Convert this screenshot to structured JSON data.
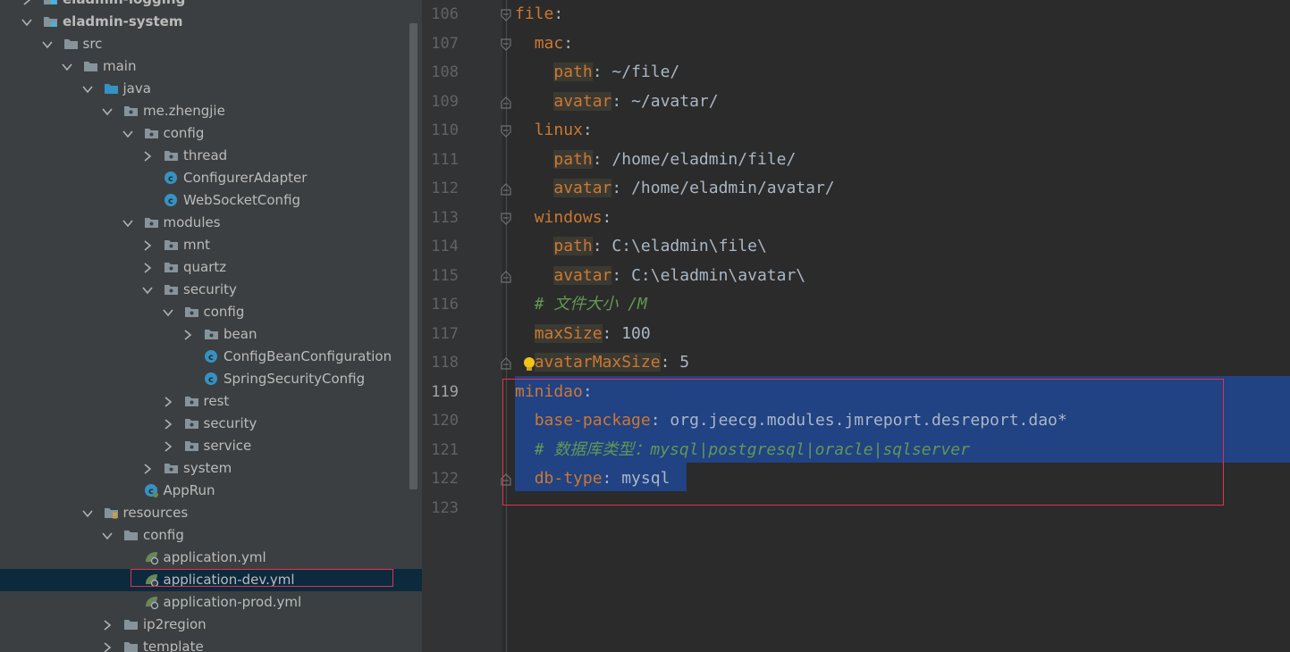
{
  "project_tree": {
    "rows": [
      {
        "label": "eladmin-logging",
        "icon": "module-folder-icon",
        "expanded": false,
        "bold": true
      },
      {
        "label": "eladmin-system",
        "icon": "module-folder-icon",
        "expanded": true,
        "bold": true
      },
      {
        "label": "src",
        "icon": "folder-icon",
        "expanded": true
      },
      {
        "label": "main",
        "icon": "folder-icon",
        "expanded": true
      },
      {
        "label": "java",
        "icon": "source-folder-icon",
        "expanded": true
      },
      {
        "label": "me.zhengjie",
        "icon": "package-icon",
        "expanded": true
      },
      {
        "label": "config",
        "icon": "package-icon",
        "expanded": true
      },
      {
        "label": "thread",
        "icon": "package-icon",
        "expanded": false
      },
      {
        "label": "ConfigurerAdapter",
        "icon": "java-class-icon"
      },
      {
        "label": "WebSocketConfig",
        "icon": "java-class-icon"
      },
      {
        "label": "modules",
        "icon": "package-icon",
        "expanded": true
      },
      {
        "label": "mnt",
        "icon": "package-icon",
        "expanded": false
      },
      {
        "label": "quartz",
        "icon": "package-icon",
        "expanded": false
      },
      {
        "label": "security",
        "icon": "package-icon",
        "expanded": true
      },
      {
        "label": "config",
        "icon": "package-icon",
        "expanded": true
      },
      {
        "label": "bean",
        "icon": "package-icon",
        "expanded": false
      },
      {
        "label": "ConfigBeanConfiguration",
        "icon": "java-class-icon"
      },
      {
        "label": "SpringSecurityConfig",
        "icon": "java-class-icon"
      },
      {
        "label": "rest",
        "icon": "package-icon",
        "expanded": false
      },
      {
        "label": "security",
        "icon": "package-icon",
        "expanded": false
      },
      {
        "label": "service",
        "icon": "package-icon",
        "expanded": false
      },
      {
        "label": "system",
        "icon": "package-icon",
        "expanded": false
      },
      {
        "label": "AppRun",
        "icon": "spring-boot-class-icon"
      },
      {
        "label": "resources",
        "icon": "resources-folder-icon",
        "expanded": true
      },
      {
        "label": "config",
        "icon": "folder-icon",
        "expanded": true
      },
      {
        "label": "application.yml",
        "icon": "spring-yml-icon"
      },
      {
        "label": "application-dev.yml",
        "icon": "spring-yml-icon",
        "selected": true
      },
      {
        "label": "application-prod.yml",
        "icon": "spring-yml-icon"
      },
      {
        "label": "ip2region",
        "icon": "folder-icon",
        "expanded": false
      },
      {
        "label": "template",
        "icon": "folder-icon",
        "expanded": false
      }
    ]
  },
  "editor": {
    "file": "application-dev.yml",
    "current_line": 119,
    "lines": [
      {
        "num": "106",
        "segs": [
          {
            "t": "file",
            "c": "k"
          },
          {
            "t": ":",
            "c": "v"
          }
        ]
      },
      {
        "num": "107",
        "segs": [
          {
            "t": "  "
          },
          {
            "t": "mac",
            "c": "k"
          },
          {
            "t": ":",
            "c": "v"
          }
        ]
      },
      {
        "num": "108",
        "segs": [
          {
            "t": "    "
          },
          {
            "t": "path",
            "c": "k hl"
          },
          {
            "t": ": ~/file/",
            "c": "v"
          }
        ]
      },
      {
        "num": "109",
        "segs": [
          {
            "t": "    "
          },
          {
            "t": "avatar",
            "c": "k hl"
          },
          {
            "t": ": ~/avatar/",
            "c": "v"
          }
        ]
      },
      {
        "num": "110",
        "segs": [
          {
            "t": "  "
          },
          {
            "t": "linux",
            "c": "k"
          },
          {
            "t": ":",
            "c": "v"
          }
        ]
      },
      {
        "num": "111",
        "segs": [
          {
            "t": "    "
          },
          {
            "t": "path",
            "c": "k hl"
          },
          {
            "t": ": /home/eladmin/file/",
            "c": "v"
          }
        ]
      },
      {
        "num": "112",
        "segs": [
          {
            "t": "    "
          },
          {
            "t": "avatar",
            "c": "k hl"
          },
          {
            "t": ": /home/eladmin/avatar/",
            "c": "v"
          }
        ]
      },
      {
        "num": "113",
        "segs": [
          {
            "t": "  "
          },
          {
            "t": "windows",
            "c": "k"
          },
          {
            "t": ":",
            "c": "v"
          }
        ]
      },
      {
        "num": "114",
        "segs": [
          {
            "t": "    "
          },
          {
            "t": "path",
            "c": "k hl"
          },
          {
            "t": ": C:\\eladmin\\file\\",
            "c": "v"
          }
        ]
      },
      {
        "num": "115",
        "segs": [
          {
            "t": "    "
          },
          {
            "t": "avatar",
            "c": "k hl"
          },
          {
            "t": ": C:\\eladmin\\avatar\\",
            "c": "v"
          }
        ]
      },
      {
        "num": "116",
        "segs": [
          {
            "t": "  "
          },
          {
            "t": "# 文件大小 /M",
            "c": "c"
          }
        ]
      },
      {
        "num": "117",
        "segs": [
          {
            "t": "  "
          },
          {
            "t": "maxSize",
            "c": "k hl"
          },
          {
            "t": ": 100",
            "c": "v"
          }
        ]
      },
      {
        "num": "118",
        "segs": [
          {
            "t": "  "
          },
          {
            "t": "avatarMaxSize",
            "c": "k hl"
          },
          {
            "t": ": 5",
            "c": "v"
          }
        ]
      },
      {
        "num": "119",
        "segs": [
          {
            "t": "minidao",
            "c": "k"
          },
          {
            "t": ":",
            "c": "v"
          }
        ]
      },
      {
        "num": "120",
        "segs": [
          {
            "t": "  "
          },
          {
            "t": "base-package",
            "c": "k"
          },
          {
            "t": ": org.jeecg.modules.jmreport.desreport.dao*",
            "c": "v"
          }
        ]
      },
      {
        "num": "121",
        "segs": [
          {
            "t": "  "
          },
          {
            "t": "# 数据库类型：mysql|postgresql|oracle|sqlserver",
            "c": "c"
          }
        ]
      },
      {
        "num": "122",
        "segs": [
          {
            "t": "  "
          },
          {
            "t": "db-type",
            "c": "k"
          },
          {
            "t": ": mysql",
            "c": "v"
          }
        ]
      },
      {
        "num": "123",
        "segs": []
      }
    ]
  },
  "colors": {
    "tree_bg": "#3c3f41",
    "editor_bg": "#2b2b2b",
    "selection": "#214283",
    "yaml_key": "#cc7832",
    "comment": "#629755",
    "annotation_box": "#e0334d"
  }
}
